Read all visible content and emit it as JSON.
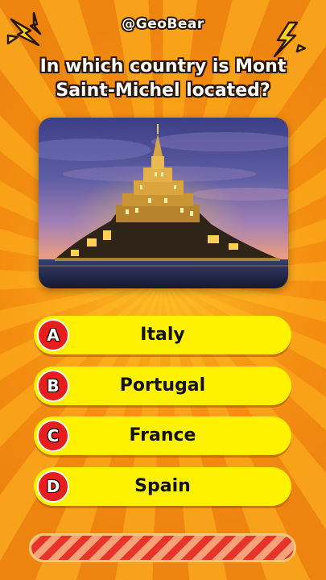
{
  "handle": "@GeoBear",
  "question": "In which country is Mont Saint-Michel located?",
  "answers": [
    {
      "letter": "A",
      "text": "Italy"
    },
    {
      "letter": "B",
      "text": "Portugal"
    },
    {
      "letter": "C",
      "text": "France"
    },
    {
      "letter": "D",
      "text": "Spain"
    }
  ],
  "timer": {
    "progress_fraction": 1.0
  },
  "colors": {
    "background": "#f28a0c",
    "answer_bg": "#fff200",
    "badge_bg": "#e61e1e",
    "timer_stripe_a": "#e8332b",
    "timer_stripe_b": "#f6a37a"
  },
  "icons": {
    "left": "lightning-bolt-icon",
    "right": "lightning-bolt-icon"
  }
}
